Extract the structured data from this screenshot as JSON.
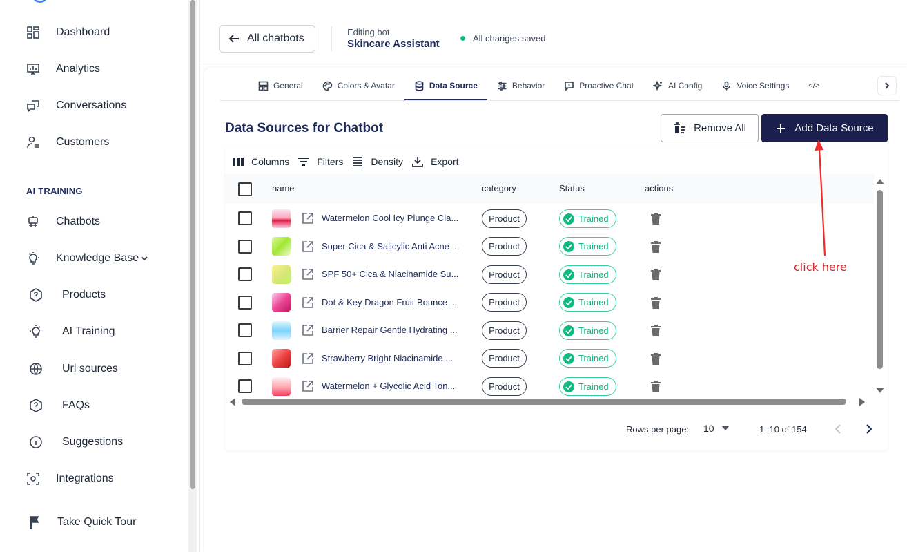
{
  "sidebar": {
    "items": [
      {
        "label": "Dashboard",
        "icon": "dashboard-icon"
      },
      {
        "label": "Analytics",
        "icon": "analytics-icon"
      },
      {
        "label": "Conversations",
        "icon": "conversations-icon"
      },
      {
        "label": "Customers",
        "icon": "customers-icon"
      }
    ],
    "section_label": "AI TRAINING",
    "training_items": [
      {
        "label": "Chatbots",
        "icon": "robot-icon"
      },
      {
        "label": "Knowledge Base",
        "icon": "lightbulb-icon"
      },
      {
        "label": "Products",
        "icon": "help-circle-icon"
      },
      {
        "label": "AI Training",
        "icon": "lightbulb-icon"
      },
      {
        "label": "Url sources",
        "icon": "globe-icon"
      },
      {
        "label": "FAQs",
        "icon": "help-circle-icon"
      },
      {
        "label": "Suggestions",
        "icon": "info-icon"
      },
      {
        "label": "Integrations",
        "icon": "integrations-icon"
      }
    ],
    "tour_label": "Take Quick Tour"
  },
  "header": {
    "back_label": "All chatbots",
    "editing_label": "Editing bot",
    "bot_name": "Skincare Assistant",
    "saved_status": "All changes saved",
    "saved_color": "#10b981"
  },
  "tabs": [
    {
      "label": "General",
      "icon": "layout-icon"
    },
    {
      "label": "Colors & Avatar",
      "icon": "palette-icon"
    },
    {
      "label": "Data Source",
      "icon": "database-icon",
      "active": true
    },
    {
      "label": "Behavior",
      "icon": "sliders-icon"
    },
    {
      "label": "Proactive Chat",
      "icon": "message-alert-icon"
    },
    {
      "label": "AI Config",
      "icon": "sparkles-icon"
    },
    {
      "label": "Voice Settings",
      "icon": "microphone-icon"
    },
    {
      "label": "</>",
      "icon": "code-icon"
    }
  ],
  "main": {
    "title": "Data Sources for Chatbot",
    "remove_all_label": "Remove All",
    "add_label": "Add Data Source",
    "accent_color": "#1a1f4d"
  },
  "toolbar": {
    "columns": "Columns",
    "filters": "Filters",
    "density": "Density",
    "export": "Export"
  },
  "table": {
    "columns": [
      "name",
      "category",
      "Status",
      "actions"
    ],
    "rows": [
      {
        "name": "Watermelon Cool Icy Plunge Cla...",
        "category": "Product",
        "status": "Trained"
      },
      {
        "name": "Super Cica & Salicylic Anti Acne ...",
        "category": "Product",
        "status": "Trained"
      },
      {
        "name": "SPF 50+ Cica & Niacinamide Su...",
        "category": "Product",
        "status": "Trained"
      },
      {
        "name": "Dot & Key Dragon Fruit Bounce ...",
        "category": "Product",
        "status": "Trained"
      },
      {
        "name": "Barrier Repair Gentle Hydrating ...",
        "category": "Product",
        "status": "Trained"
      },
      {
        "name": "Strawberry Bright Niacinamide ...",
        "category": "Product",
        "status": "Trained"
      },
      {
        "name": "Watermelon + Glycolic Acid Ton...",
        "category": "Product",
        "status": "Trained"
      }
    ]
  },
  "pagination": {
    "rows_per_page_label": "Rows per page:",
    "rows_per_page": "10",
    "range": "1–10 of 154"
  },
  "annotation": {
    "text": "click here",
    "color": "#dc2626"
  }
}
